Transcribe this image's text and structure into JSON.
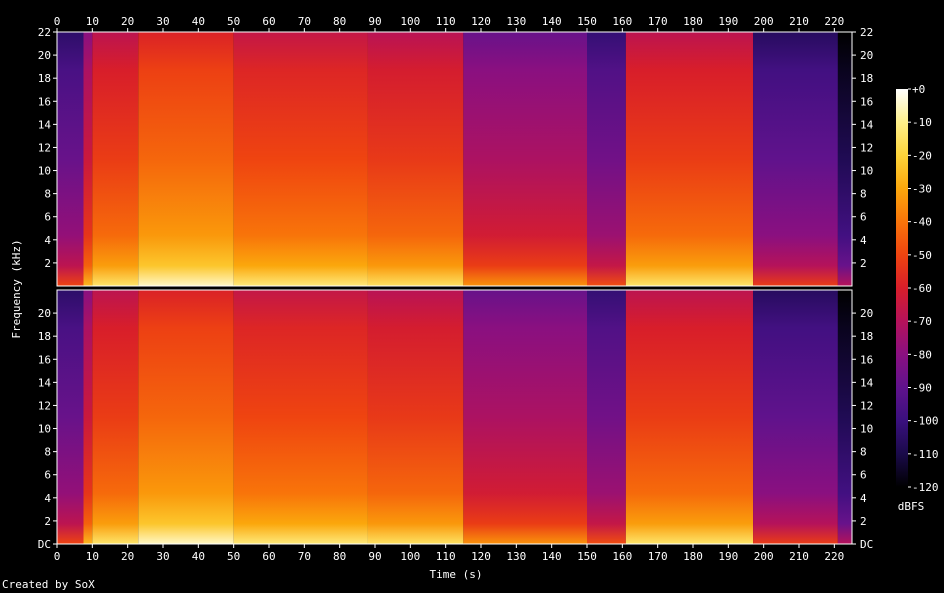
{
  "chart_data": {
    "type": "heatmap",
    "title": "",
    "xlabel": "Time (s)",
    "ylabel": "Frequency (kHz)",
    "xlim": [
      0,
      225
    ],
    "ylim": [
      0,
      22
    ],
    "x_ticks": [
      0,
      10,
      20,
      30,
      40,
      50,
      60,
      70,
      80,
      90,
      100,
      110,
      120,
      130,
      140,
      150,
      160,
      170,
      180,
      190,
      200,
      210,
      220
    ],
    "y_tick_values": [
      0,
      2,
      4,
      6,
      8,
      10,
      12,
      14,
      16,
      18,
      20,
      22
    ],
    "y_tick_labels": [
      "DC",
      "2",
      "4",
      "6",
      "8",
      "10",
      "12",
      "14",
      "16",
      "18",
      "20",
      "22"
    ],
    "y_tick_labels_lower": [
      "DC",
      "2",
      "4",
      "6",
      "8",
      "10",
      "12",
      "14",
      "16",
      "18",
      "20"
    ],
    "channels": 2,
    "colorbar": {
      "label": "dBFS",
      "range": [
        -120,
        0
      ],
      "ticks": [
        "+0",
        "-10",
        "-20",
        "-30",
        "-40",
        "-50",
        "-60",
        "-70",
        "-80",
        "-90",
        "-100",
        "-110",
        "-120"
      ],
      "colors": [
        "#000000",
        "#1a0a4a",
        "#3a107e",
        "#60128c",
        "#8a1080",
        "#b5125a",
        "#d81e2a",
        "#ef4410",
        "#f8740a",
        "#fba70c",
        "#fdd43a",
        "#fef08a",
        "#ffffff"
      ]
    },
    "segments": [
      {
        "t": [
          0,
          7.5
        ],
        "level": -90
      },
      {
        "t": [
          7.5,
          10
        ],
        "level": -66
      },
      {
        "t": [
          10,
          23
        ],
        "level": -54
      },
      {
        "t": [
          23,
          50
        ],
        "level": -45
      },
      {
        "t": [
          50,
          88
        ],
        "level": -52
      },
      {
        "t": [
          88,
          115
        ],
        "level": -55
      },
      {
        "t": [
          115,
          150
        ],
        "level": -74
      },
      {
        "t": [
          150,
          161
        ],
        "level": -88
      },
      {
        "t": [
          161,
          197
        ],
        "level": -54
      },
      {
        "t": [
          197,
          221
        ],
        "level": -92
      },
      {
        "t": [
          221,
          225
        ],
        "level": -110
      }
    ]
  },
  "footer": {
    "credit": "Created by SoX"
  }
}
